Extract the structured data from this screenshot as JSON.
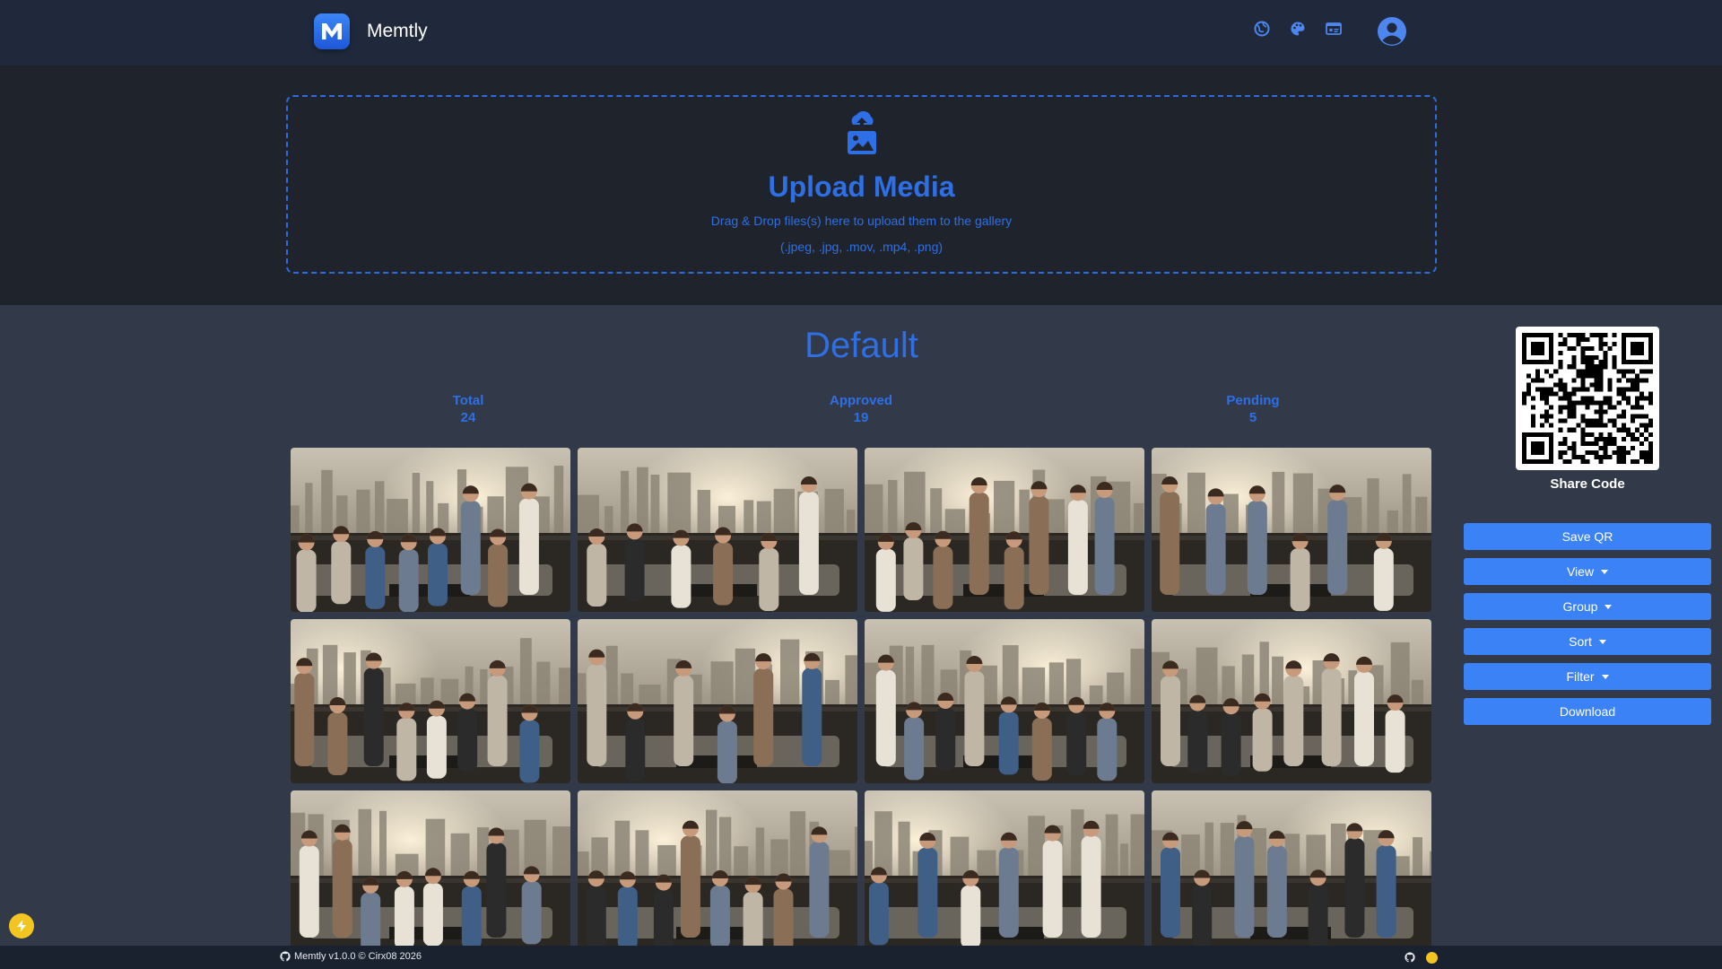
{
  "app": {
    "name": "Memtly",
    "logo_letter": "M"
  },
  "header": {
    "icons": [
      "globe-icon",
      "palette-icon",
      "id-card-icon"
    ],
    "avatar": "user-circle-icon"
  },
  "upload": {
    "title": "Upload Media",
    "description": "Drag & Drop files(s) here to upload them to the gallery",
    "types": "(.jpeg, .jpg, .mov, .mp4, .png)"
  },
  "gallery": {
    "title": "Default",
    "stats": {
      "total_label": "Total",
      "total_value": "24",
      "approved_label": "Approved",
      "approved_value": "19",
      "pending_label": "Pending",
      "pending_value": "5"
    },
    "photos": [
      {
        "alt": "rooftop party photo 1"
      },
      {
        "alt": "rooftop party photo 2"
      },
      {
        "alt": "rooftop party photo 3"
      },
      {
        "alt": "rooftop party photo 4"
      },
      {
        "alt": "rooftop party photo 5"
      },
      {
        "alt": "rooftop party photo 6"
      },
      {
        "alt": "rooftop party photo 7"
      },
      {
        "alt": "rooftop party photo 8"
      },
      {
        "alt": "rooftop party photo 9"
      },
      {
        "alt": "rooftop party photo 10"
      },
      {
        "alt": "rooftop party photo 11"
      },
      {
        "alt": "rooftop party photo 12"
      }
    ]
  },
  "sidebar": {
    "share_label": "Share Code",
    "buttons": {
      "save_qr": "Save QR",
      "view": "View",
      "group": "Group",
      "sort": "Sort",
      "filter": "Filter",
      "download": "Download"
    }
  },
  "footer": {
    "text": "Memtly v1.0.0 © Cirx08 2026"
  },
  "colors": {
    "accent": "#2e6fe6",
    "button": "#3b82f6",
    "navbar": "#1f293b",
    "upload_bg": "#1f242c",
    "page_bg": "#323a49",
    "fab": "#f2c521"
  }
}
